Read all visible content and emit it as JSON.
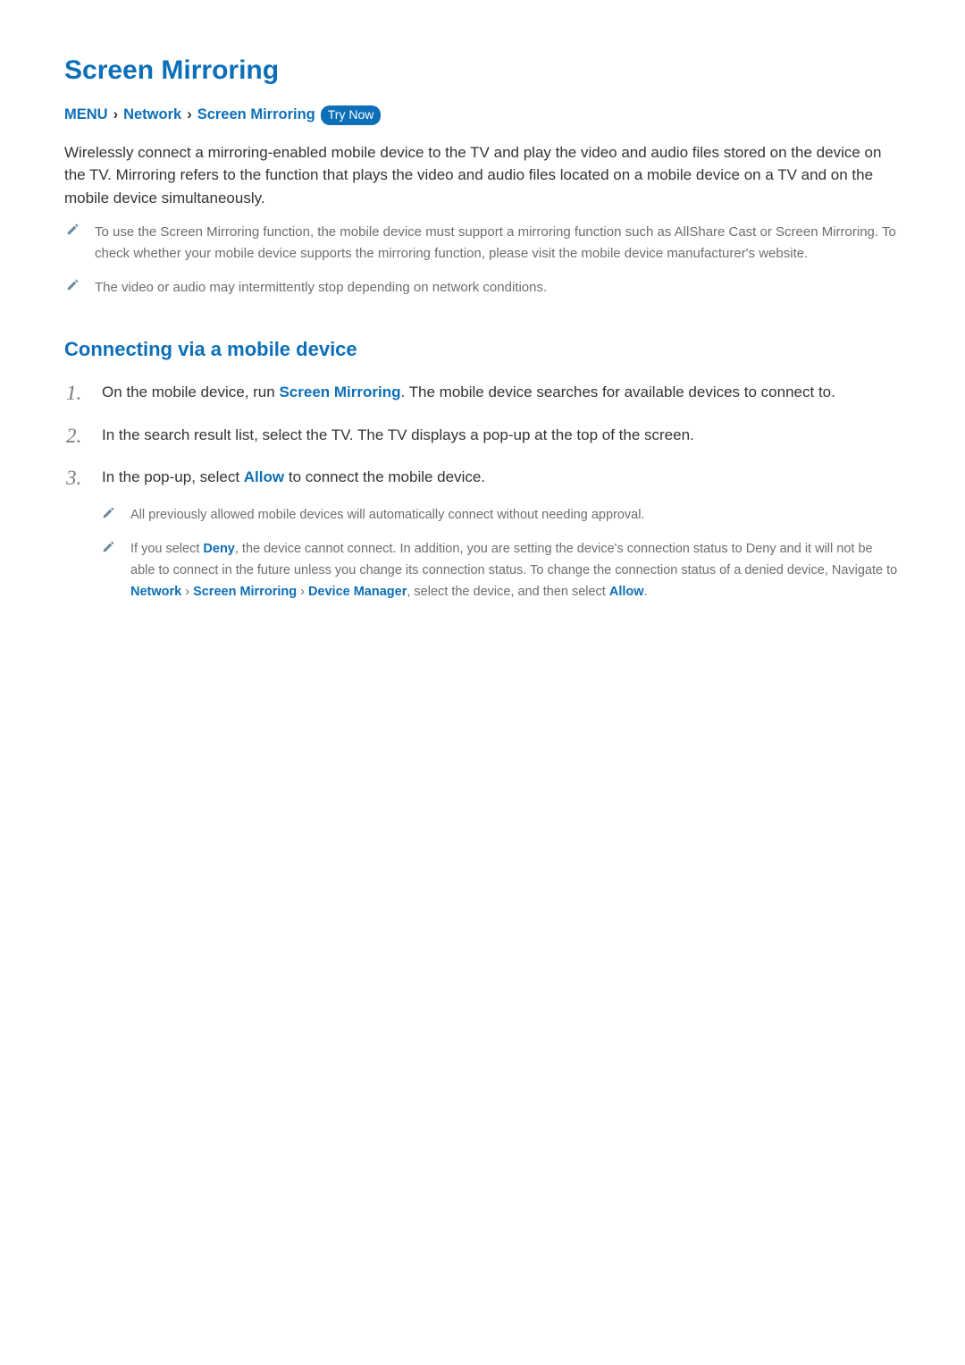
{
  "title": "Screen Mirroring",
  "breadcrumb": {
    "menu": "MENU",
    "network": "Network",
    "screen_mirroring": "Screen Mirroring",
    "try_now": "Try Now"
  },
  "intro": "Wirelessly connect a mirroring-enabled mobile device to the TV and play the video and audio files stored on the device on the TV. Mirroring refers to the function that plays the video and audio files located on a mobile device on a TV and on the mobile device simultaneously.",
  "notes": [
    "To use the Screen Mirroring function, the mobile device must support a mirroring function such as AllShare Cast or Screen Mirroring. To check whether your mobile device supports the mirroring function, please visit the mobile device manufacturer's website.",
    "The video or audio may intermittently stop depending on network conditions."
  ],
  "section_title": "Connecting via a mobile device",
  "steps": {
    "s1_pre": "On the mobile device, run ",
    "s1_bold": "Screen Mirroring",
    "s1_post": ". The mobile device searches for available devices to connect to.",
    "s2": "In the search result list, select the TV. The TV displays a pop-up at the top of the screen.",
    "s3_pre": "In the pop-up, select ",
    "s3_bold": "Allow",
    "s3_post": " to connect the mobile device."
  },
  "sub_notes": {
    "n1": "All previously allowed mobile devices will automatically connect without needing approval.",
    "n2_pre": "If you select ",
    "n2_deny": "Deny",
    "n2_mid": ", the device cannot connect. In addition, you are setting the device's connection status to Deny and it will not be able to connect in the future unless you change its connection status. To change the connection status of a denied device, Navigate to ",
    "n2_network": "Network",
    "n2_sm": "Screen Mirroring",
    "n2_dm": "Device Manager",
    "n2_post1": ", select the device, and then select ",
    "n2_allow": "Allow",
    "n2_post2": "."
  },
  "glyphs": {
    "chevron": "›"
  }
}
